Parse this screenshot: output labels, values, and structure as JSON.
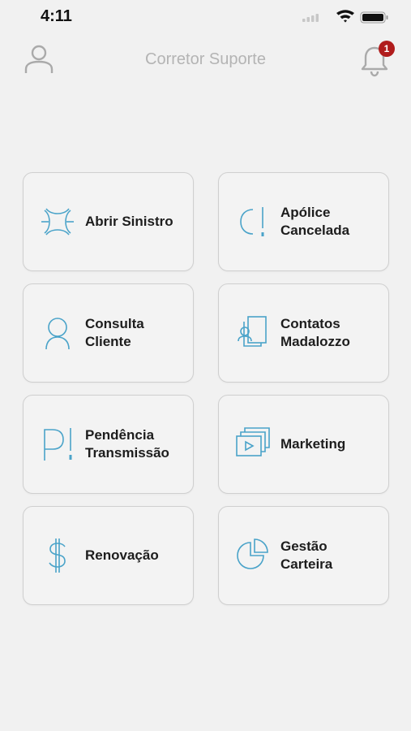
{
  "status_bar": {
    "time": "4:11"
  },
  "header": {
    "title": "Corretor Suporte",
    "notification_count": "1"
  },
  "cards": [
    {
      "line1": "Abrir Sinistro",
      "line2": "",
      "icon": "claim-icon"
    },
    {
      "line1": "Apólice",
      "line2": "Cancelada",
      "icon": "policy-cancelled-icon"
    },
    {
      "line1": "Consulta",
      "line2": "Cliente",
      "icon": "person-icon"
    },
    {
      "line1": "Contatos",
      "line2": "Madalozzo",
      "icon": "contacts-icon"
    },
    {
      "line1": "Pendência",
      "line2": "Transmissão",
      "icon": "pending-icon"
    },
    {
      "line1": "Marketing",
      "line2": "",
      "icon": "video-icon"
    },
    {
      "line1": "Renovação",
      "line2": "",
      "icon": "dollar-icon"
    },
    {
      "line1": "Gestão",
      "line2": "Carteira",
      "icon": "pie-chart-icon"
    }
  ],
  "colors": {
    "accent": "#4aa3c9",
    "badge": "#b01c1c",
    "title": "#b4b4b4"
  }
}
